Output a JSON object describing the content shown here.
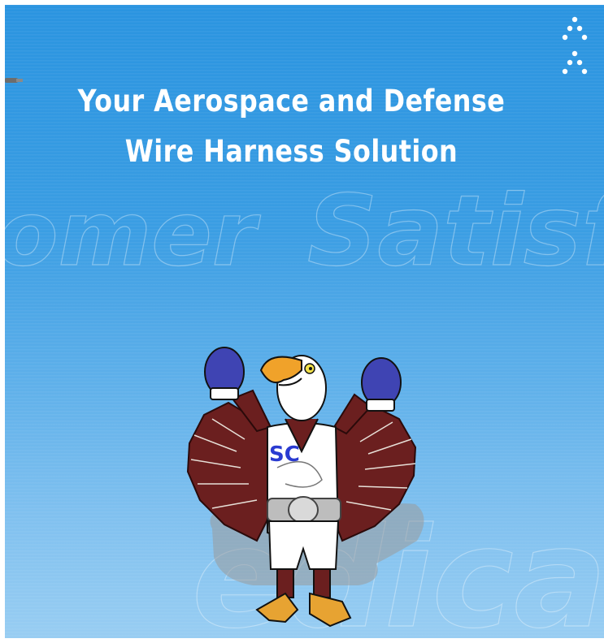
{
  "headline": {
    "line1": "Your Aerospace and Defense",
    "line2": "Wire Harness Solution"
  },
  "watermark": {
    "word1": "omer",
    "word2": "Satisfac",
    "word3": "edica"
  },
  "mascot": {
    "chest_logo": "SC"
  },
  "icons": {
    "nav": "chevron-up-double-icon",
    "pin": "pin-icon"
  },
  "colors": {
    "background_top": "#2a94e0",
    "background_bottom": "#98cdf2",
    "text": "#ffffff",
    "glove": "#3f44b3",
    "wing": "#6b1f1f",
    "beak": "#f0a22a"
  }
}
